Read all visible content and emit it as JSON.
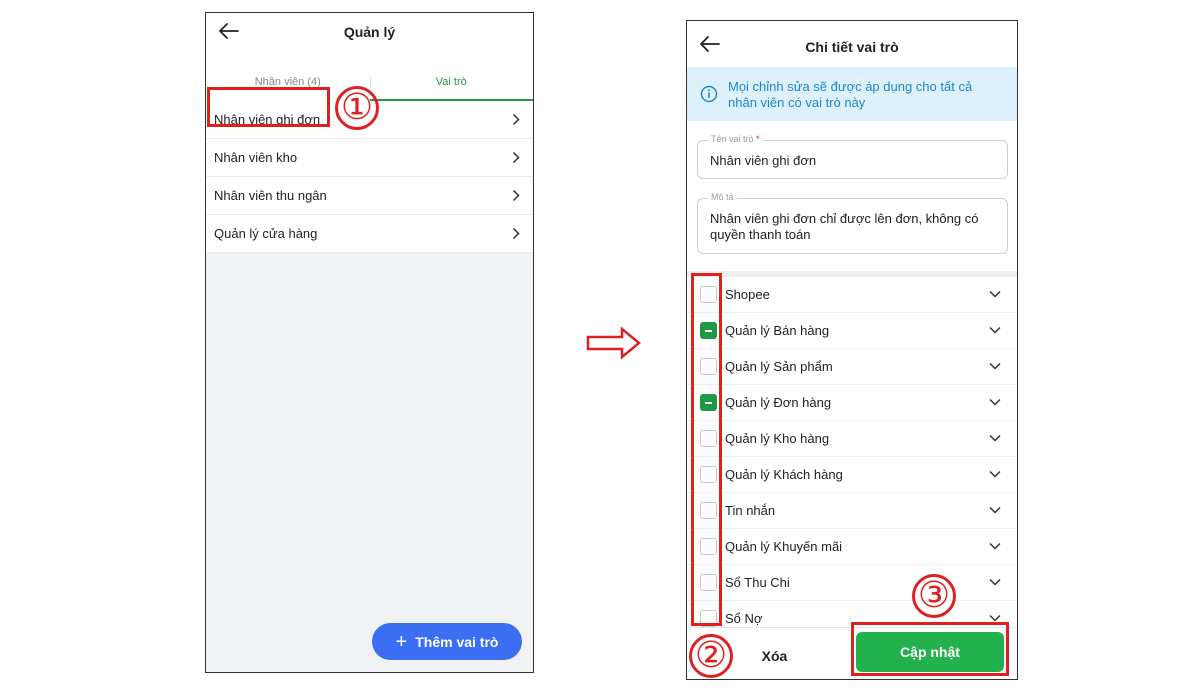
{
  "left_screen": {
    "header": {
      "title": "Quản lý"
    },
    "tabs": [
      {
        "label": "Nhân viên (4)"
      },
      {
        "label": "Vai trò"
      }
    ],
    "roles": [
      {
        "label": "Nhân viên ghi đơn"
      },
      {
        "label": "Nhân viên kho"
      },
      {
        "label": "Nhân viên thu ngân"
      },
      {
        "label": "Quản lý cửa hàng"
      }
    ],
    "add_button": {
      "icon": "plus-icon",
      "label": "Thêm vai trò"
    }
  },
  "right_screen": {
    "header": {
      "title": "Chi tiết vai trò"
    },
    "info_banner": {
      "icon": "info-icon",
      "text": "Mọi chỉnh sửa sẽ được áp dụng cho tất cả nhân viên có vai trò này"
    },
    "role_name_field": {
      "label": "Tên vai trò",
      "required_mark": "*",
      "value": "Nhân viên ghi đơn"
    },
    "description_field": {
      "label": "Mô tả",
      "value": "Nhân viên ghi đơn chỉ được lên đơn, không có quyền thanh toán"
    },
    "permissions": [
      {
        "label": "Shopee",
        "state": "unchecked"
      },
      {
        "label": "Quản lý Bán hàng",
        "state": "partial"
      },
      {
        "label": "Quản lý Sản phẩm",
        "state": "unchecked"
      },
      {
        "label": "Quản lý Đơn hàng",
        "state": "partial"
      },
      {
        "label": "Quản lý Kho hàng",
        "state": "unchecked"
      },
      {
        "label": "Quản lý Khách hàng",
        "state": "unchecked"
      },
      {
        "label": "Tin nhắn",
        "state": "unchecked"
      },
      {
        "label": "Quản lý Khuyến mãi",
        "state": "unchecked"
      },
      {
        "label": "Sổ Thu Chi",
        "state": "unchecked"
      },
      {
        "label": "Sổ Nợ",
        "state": "unchecked"
      }
    ],
    "footer": {
      "delete_label": "Xóa",
      "update_label": "Cập nhật"
    }
  },
  "annotations": {
    "step1": "①",
    "step2": "②",
    "step3": "③",
    "highlight_color": "#e02020"
  },
  "colors": {
    "accent_green": "#1f9a3f",
    "update_green": "#22b14c",
    "add_blue": "#3b6ef3",
    "info_bg": "#dcf1fb",
    "info_text": "#1f87c6"
  }
}
